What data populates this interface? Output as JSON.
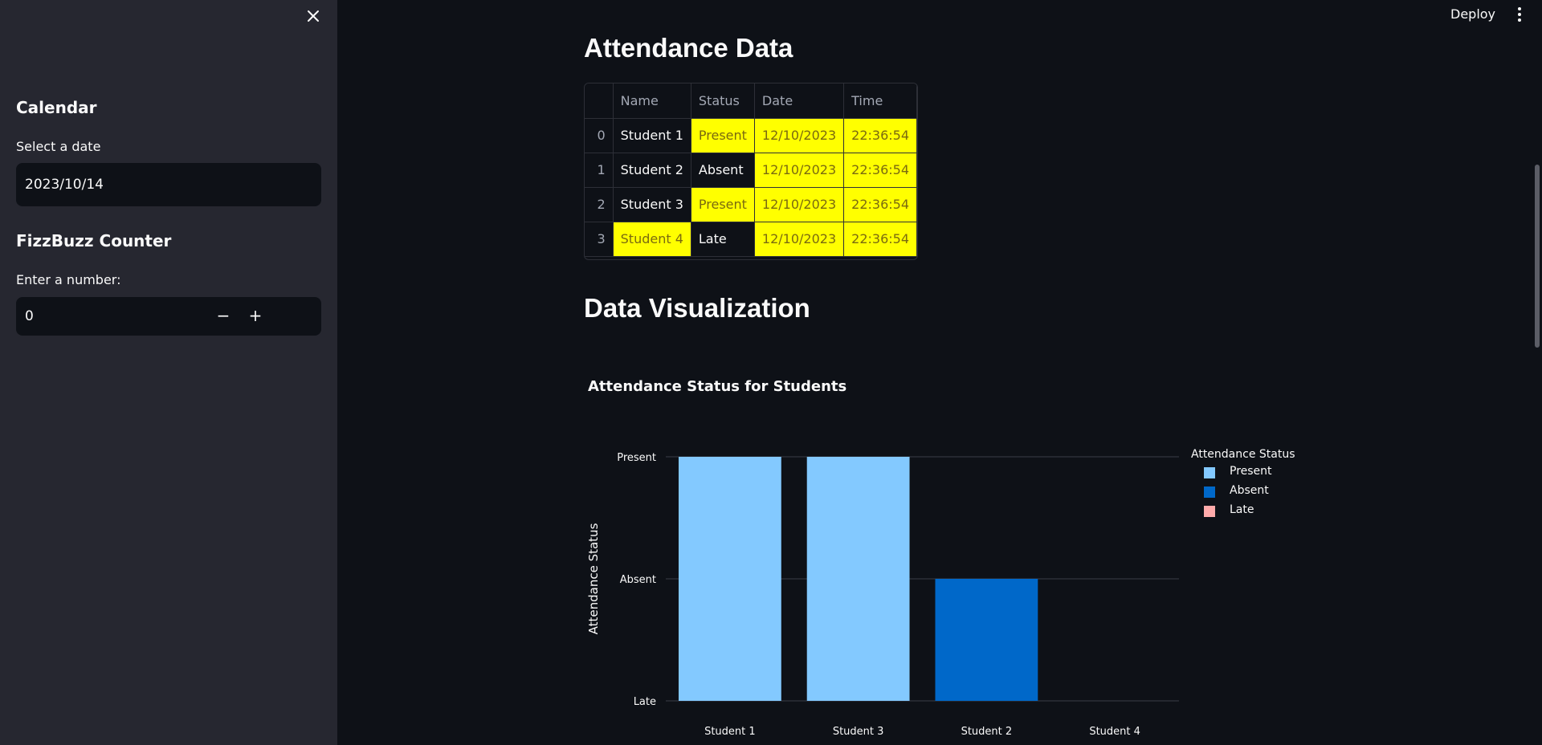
{
  "sidebar": {
    "calendar_heading": "Calendar",
    "date_label": "Select a date",
    "date_value": "2023/10/14",
    "fizzbuzz_heading": "FizzBuzz Counter",
    "number_label": "Enter a number:",
    "number_value": "0",
    "decrement_label": "−",
    "increment_label": "+"
  },
  "header": {
    "deploy_label": "Deploy",
    "menu_icon": "vertical-dots-icon",
    "close_icon": "close-icon"
  },
  "main": {
    "attendance_title": "Attendance Data",
    "viz_title": "Data Visualization",
    "table": {
      "columns": [
        "",
        "Name",
        "Status",
        "Date",
        "Time"
      ],
      "rows": [
        {
          "index": "0",
          "name": "Student 1",
          "status": "Present",
          "date": "12/10/2023",
          "time": "22:36:54",
          "highlight": [
            "status",
            "date",
            "time"
          ]
        },
        {
          "index": "1",
          "name": "Student 2",
          "status": "Absent",
          "date": "12/10/2023",
          "time": "22:36:54",
          "highlight": [
            "date",
            "time"
          ]
        },
        {
          "index": "2",
          "name": "Student 3",
          "status": "Present",
          "date": "12/10/2023",
          "time": "22:36:54",
          "highlight": [
            "status",
            "date",
            "time"
          ]
        },
        {
          "index": "3",
          "name": "Student 4",
          "status": "Late",
          "date": "12/10/2023",
          "time": "22:36:54",
          "highlight": [
            "name",
            "date",
            "time"
          ]
        }
      ],
      "highlight_color": "#ffff00"
    }
  },
  "chart_data": {
    "type": "bar",
    "title": "Attendance Status for Students",
    "xlabel": "",
    "ylabel": "Attendance Status",
    "categories": [
      "Student 1",
      "Student 3",
      "Student 2",
      "Student 4"
    ],
    "y_categories": [
      "Late",
      "Absent",
      "Present"
    ],
    "values": [
      "Present",
      "Present",
      "Absent",
      "Late"
    ],
    "bar_colors": [
      "#83c9ff",
      "#83c9ff",
      "#0068c9",
      "#ffabab"
    ],
    "legend": {
      "title": "Attendance Status",
      "placement": "right",
      "entries": [
        {
          "name": "Present",
          "color": "#83c9ff"
        },
        {
          "name": "Absent",
          "color": "#0068c9"
        },
        {
          "name": "Late",
          "color": "#ffabab"
        }
      ]
    },
    "grid": true
  }
}
